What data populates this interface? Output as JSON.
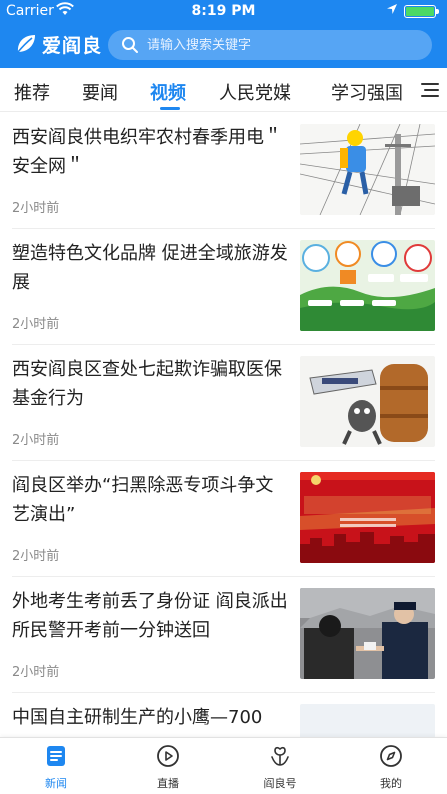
{
  "status": {
    "carrier": "Carrier",
    "time": "8:19 PM"
  },
  "app": {
    "name": "爱阎良",
    "search_placeholder": "请输入搜索关键字"
  },
  "tabs": [
    {
      "label": "推荐"
    },
    {
      "label": "要闻"
    },
    {
      "label": "视频",
      "active": true
    },
    {
      "label": "人民党媒"
    },
    {
      "label": "学习强国"
    }
  ],
  "feed": [
    {
      "title": "西安阎良供电织牢农村春季用电＂安全网＂",
      "time": "2小时前",
      "image": "electric-worker-illustration"
    },
    {
      "title": "塑造特色文化品牌 促进全域旅游发展",
      "time": "2小时前",
      "image": "culture-tourism-illustration"
    },
    {
      "title": "西安阎良区查处七起欺诈骗取医保基金行为",
      "time": "2小时前",
      "image": "medical-insurance-fraud-cartoon"
    },
    {
      "title": "阎良区举办“扫黑除恶专项斗争文艺演出”",
      "time": "2小时前",
      "image": "anti-crime-red-banner"
    },
    {
      "title": "外地考生考前丢了身份证 阎良派出所民警开考前一分钟送回",
      "time": "2小时前",
      "image": "police-returning-id-photo"
    },
    {
      "title": "中国自主研制生产的小鹰—700",
      "time": "",
      "image": "aircraft-photo"
    }
  ],
  "bottom_nav": [
    {
      "label": "新闻",
      "icon": "news-icon",
      "active": true
    },
    {
      "label": "直播",
      "icon": "live-icon"
    },
    {
      "label": "阎良号",
      "icon": "yanliang-account-icon"
    },
    {
      "label": "我的",
      "icon": "compass-icon"
    }
  ],
  "colors": {
    "primary": "#1e87f0",
    "text": "#222222",
    "muted": "#8a8a8a"
  }
}
